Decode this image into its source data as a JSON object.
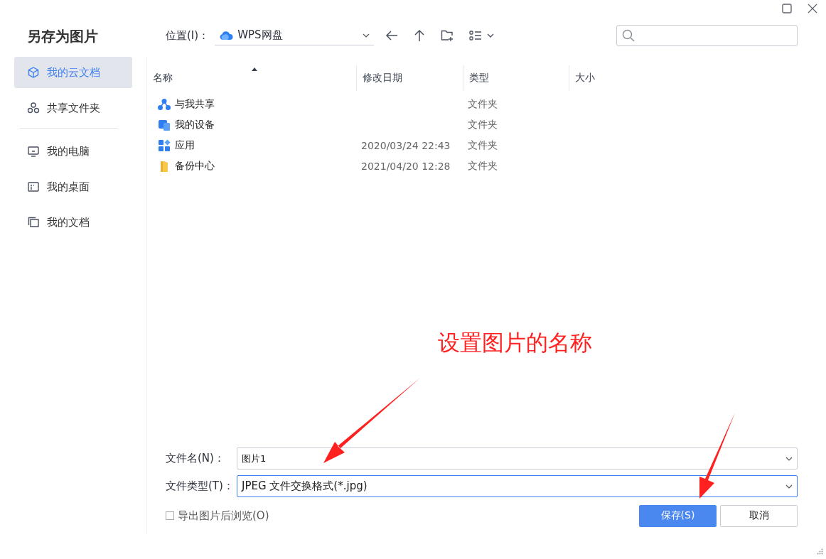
{
  "window": {
    "title": "另存为图片"
  },
  "toolbar": {
    "location_label": "位置(I)：",
    "location": "WPS网盘"
  },
  "sidebar": {
    "groups": [
      {
        "items": [
          {
            "kind": "cloud",
            "label": "我的云文档",
            "selected": true
          },
          {
            "kind": "share",
            "label": "共享文件夹",
            "selected": false
          }
        ]
      },
      {
        "items": [
          {
            "kind": "computer",
            "label": "我的电脑",
            "selected": false
          },
          {
            "kind": "desktop",
            "label": "我的桌面",
            "selected": false
          },
          {
            "kind": "documents",
            "label": "我的文档",
            "selected": false
          }
        ]
      }
    ]
  },
  "table": {
    "columns": [
      {
        "label": "名称",
        "sorted": true
      },
      {
        "label": "修改日期",
        "sorted": false
      },
      {
        "label": "类型",
        "sorted": false
      },
      {
        "label": "大小",
        "sorted": false
      }
    ],
    "rows": [
      {
        "kind": "shared",
        "name": "与我共享",
        "type": "文件夹"
      },
      {
        "kind": "device",
        "name": "我的设备",
        "type": "文件夹"
      },
      {
        "kind": "apps",
        "name": "应用",
        "modified": "2020/03/24 22:43",
        "type": "文件夹"
      },
      {
        "kind": "folder",
        "name": "备份中心",
        "modified": "2021/04/20 12:28",
        "type": "文件夹"
      }
    ]
  },
  "form": {
    "filename_label": "文件名(N)：",
    "filename": "图片1",
    "filetype_label": "文件类型(T)：",
    "filetype": "JPEG 文件交换格式(*.jpg)",
    "checkbox": {
      "label": "导出图片后浏览(O)",
      "checked": false
    },
    "buttons": [
      {
        "kind": "primary",
        "label": "保存(S)"
      },
      {
        "kind": "secondary",
        "label": "取消"
      }
    ]
  },
  "annotation": {
    "text": "设置图片的名称"
  }
}
